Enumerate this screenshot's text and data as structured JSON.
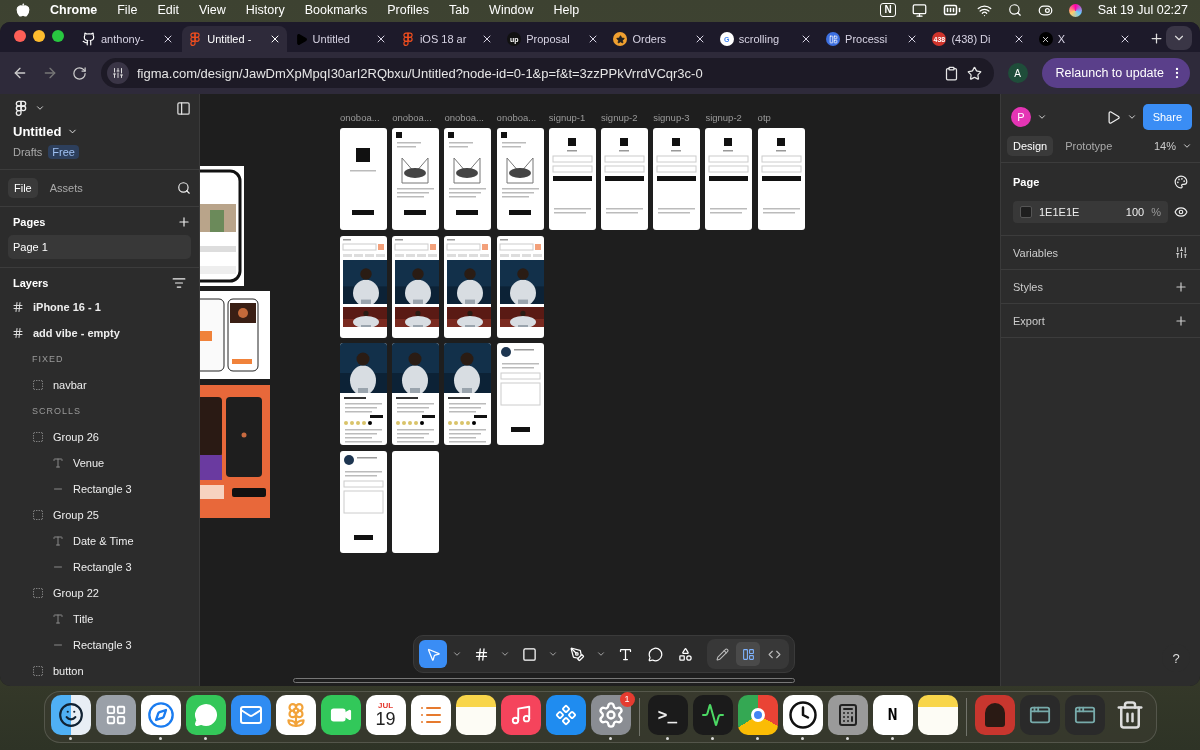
{
  "menubar": {
    "app": "Chrome",
    "menus": [
      "File",
      "Edit",
      "View",
      "History",
      "Bookmarks",
      "Profiles",
      "Tab",
      "Window",
      "Help"
    ],
    "notion_glyph": "N",
    "clock": "Sat 19 Jul 02:27"
  },
  "tabs": [
    {
      "label": "anthony-",
      "kind": "github",
      "selected": false
    },
    {
      "label": "Untitled -",
      "kind": "figma",
      "selected": true
    },
    {
      "label": "Untitled",
      "kind": "play",
      "selected": false
    },
    {
      "label": "iOS 18 ar",
      "kind": "figma",
      "selected": false
    },
    {
      "label": "Proposal",
      "kind": "up",
      "icon_text": "up",
      "selected": false
    },
    {
      "label": "Orders",
      "kind": "star",
      "selected": false
    },
    {
      "label": "scrolling",
      "kind": "google",
      "icon_text": "G",
      "selected": false
    },
    {
      "label": "Processi",
      "kind": "doc",
      "selected": false
    },
    {
      "label": "(438) Di",
      "kind": "badge",
      "icon_text": "438",
      "selected": false
    },
    {
      "label": "X",
      "kind": "x",
      "selected": false
    }
  ],
  "address": {
    "url": "figma.com/design/JawDmXpMpqI30arI2RQbxu/Untitled?node-id=0-1&p=f&t=3zzPPkVrrdVCqr3c-0",
    "profile": "A",
    "relaunch": "Relaunch to update"
  },
  "left_panel": {
    "file_name": "Untitled",
    "location": "Drafts",
    "plan": "Free",
    "tabs": [
      {
        "label": "File",
        "selected": true
      },
      {
        "label": "Assets",
        "selected": false
      }
    ],
    "pages_title": "Pages",
    "pages": [
      {
        "label": "Page 1",
        "selected": true
      }
    ],
    "layers_title": "Layers",
    "layers": [
      {
        "label": "iPhone 16 - 1",
        "kind": "frame"
      },
      {
        "label": "add vibe - empty",
        "kind": "frame",
        "children": [
          {
            "label": "FIXED",
            "kind": "section"
          },
          {
            "label": "navbar",
            "kind": "group"
          },
          {
            "label": "SCROLLS",
            "kind": "section"
          },
          {
            "label": "Group 26",
            "kind": "group",
            "children": [
              {
                "label": "Venue",
                "kind": "text"
              },
              {
                "label": "Rectangle 3",
                "kind": "line"
              }
            ]
          },
          {
            "label": "Group 25",
            "kind": "group",
            "children": [
              {
                "label": "Date & Time",
                "kind": "text"
              },
              {
                "label": "Rectangle 3",
                "kind": "line"
              }
            ]
          },
          {
            "label": "Group 22",
            "kind": "group",
            "children": [
              {
                "label": "Title",
                "kind": "text"
              },
              {
                "label": "Rectangle 3",
                "kind": "line"
              }
            ]
          },
          {
            "label": "button",
            "kind": "group"
          }
        ]
      }
    ]
  },
  "canvas": {
    "rows": [
      [
        {
          "label": "onoboa...",
          "kind": "logo"
        },
        {
          "label": "onoboa...",
          "kind": "art"
        },
        {
          "label": "onoboa...",
          "kind": "art"
        },
        {
          "label": "onoboa...",
          "kind": "art"
        },
        {
          "label": "signup-1",
          "kind": "form"
        },
        {
          "label": "signup-2",
          "kind": "form"
        },
        {
          "label": "signup-3",
          "kind": "form"
        },
        {
          "label": "signup-2",
          "kind": "form"
        },
        {
          "label": "otp",
          "kind": "form"
        }
      ],
      [
        {
          "kind": "feed"
        },
        {
          "kind": "feed"
        },
        {
          "kind": "feed"
        },
        {
          "kind": "feed"
        }
      ],
      [
        {
          "kind": "detail"
        },
        {
          "kind": "detail"
        },
        {
          "kind": "detail"
        },
        {
          "kind": "comment"
        }
      ],
      [
        {
          "kind": "comment"
        },
        {
          "kind": "blank"
        }
      ]
    ]
  },
  "right_panel": {
    "avatar": "P",
    "share": "Share",
    "tabs": [
      {
        "label": "Design",
        "selected": true
      },
      {
        "label": "Prototype",
        "selected": false
      }
    ],
    "zoom": "14%",
    "page_title": "Page",
    "fill_hex": "1E1E1E",
    "opacity": "100",
    "opacity_unit": "%",
    "sections": [
      {
        "label": "Variables",
        "kind": "variables"
      },
      {
        "label": "Styles",
        "kind": "add"
      },
      {
        "label": "Export",
        "kind": "add"
      }
    ]
  },
  "toolbar": {
    "tools": [
      {
        "kind": "move",
        "selected": true,
        "menu": true
      },
      {
        "kind": "frame",
        "selected": false,
        "menu": true
      },
      {
        "kind": "shape",
        "selected": false,
        "menu": true
      },
      {
        "kind": "pen",
        "selected": false,
        "menu": true
      },
      {
        "kind": "text",
        "selected": false,
        "menu": false
      },
      {
        "kind": "comment",
        "selected": false,
        "menu": false
      },
      {
        "kind": "actions",
        "selected": false,
        "menu": false
      }
    ],
    "modes": [
      {
        "kind": "draw",
        "selected": false
      },
      {
        "kind": "design",
        "selected": true
      },
      {
        "kind": "dev",
        "selected": false
      }
    ]
  },
  "help": "?",
  "dock": [
    {
      "kind": "finder",
      "running": true
    },
    {
      "kind": "launchpad",
      "running": false
    },
    {
      "kind": "safari",
      "running": true
    },
    {
      "kind": "messages",
      "running": true
    },
    {
      "kind": "mail",
      "running": false
    },
    {
      "kind": "photos",
      "running": false
    },
    {
      "kind": "facetime",
      "running": false
    },
    {
      "kind": "calendar",
      "month": "JUL",
      "day": "19",
      "running": false
    },
    {
      "kind": "reminders",
      "running": false
    },
    {
      "kind": "notes",
      "running": false
    },
    {
      "kind": "music",
      "running": false
    },
    {
      "kind": "appstore",
      "running": false
    },
    {
      "kind": "settings",
      "badge": "1",
      "running": true
    },
    {
      "kind": "divider"
    },
    {
      "kind": "terminal",
      "glyph": ">_",
      "running": true
    },
    {
      "kind": "activity",
      "running": true
    },
    {
      "kind": "chrome",
      "running": true
    },
    {
      "kind": "clock",
      "running": true
    },
    {
      "kind": "calculator",
      "running": true
    },
    {
      "kind": "notion",
      "glyph": "N",
      "running": true
    },
    {
      "kind": "notes",
      "running": false
    },
    {
      "kind": "divider"
    },
    {
      "kind": "avatar",
      "running": false
    },
    {
      "kind": "window",
      "running": false
    },
    {
      "kind": "window",
      "running": false
    },
    {
      "kind": "trash",
      "running": false
    }
  ]
}
